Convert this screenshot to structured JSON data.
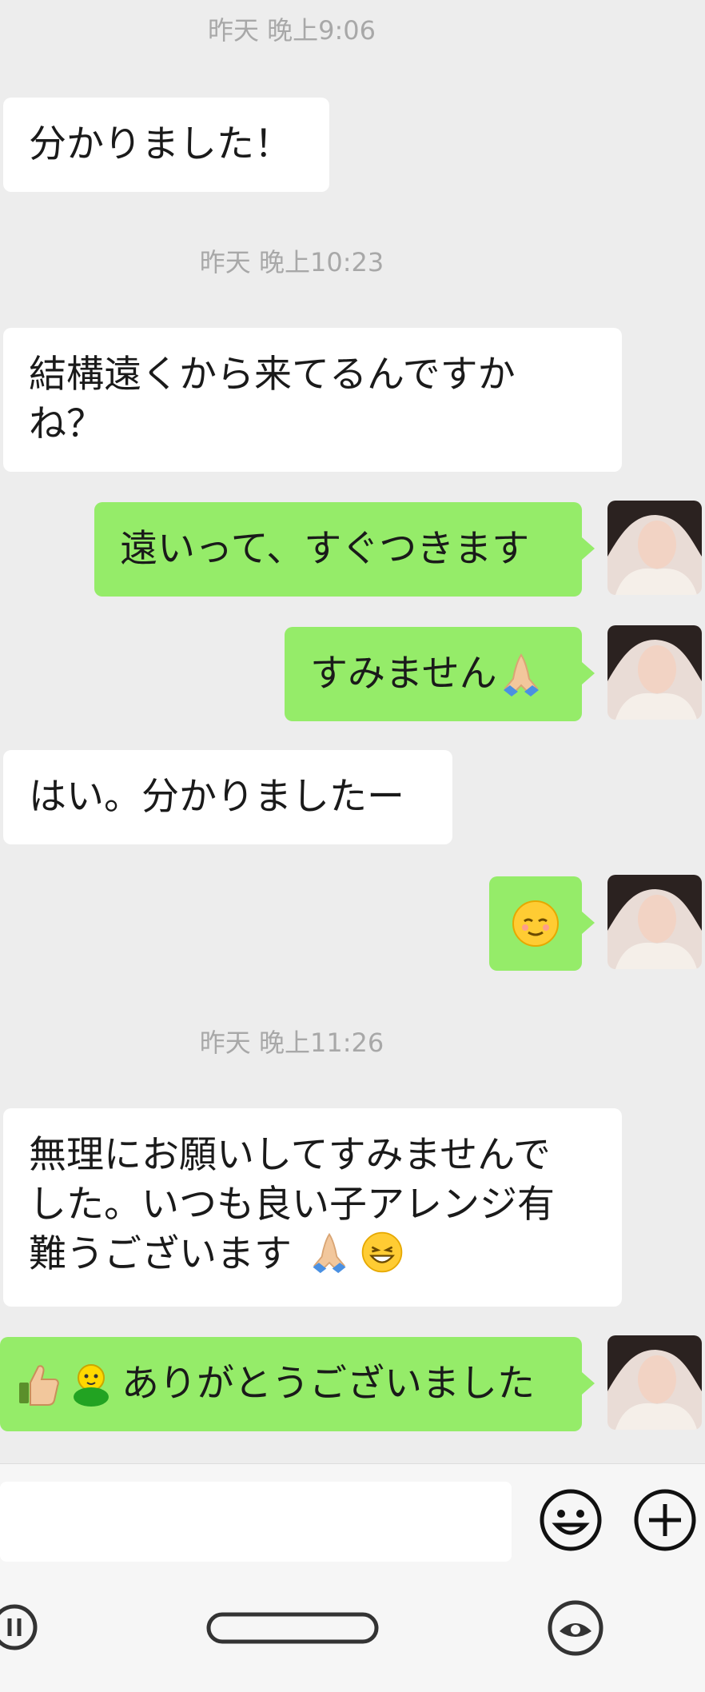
{
  "chat": {
    "timestamps": [
      "昨天 晚上9:06",
      "昨天 晚上10:23",
      "昨天 晚上11:26"
    ],
    "messages": [
      {
        "side": "received",
        "text": "分かりました！"
      },
      {
        "side": "received",
        "text": "結構遠くから来てるんですか\nね？"
      },
      {
        "side": "sent",
        "text": "遠いって、すぐつきます"
      },
      {
        "side": "sent",
        "text": "すみません",
        "emoji": "folded-hands"
      },
      {
        "side": "received",
        "text": "はい。分かりましたー"
      },
      {
        "side": "sent",
        "text": "",
        "emoji": "relieved-face"
      },
      {
        "side": "received",
        "text": "無理にお願いしてすみませんで\nした。いつも良い子アレンジ有\n難うございます",
        "emoji_trailing": [
          "folded-hands",
          "grinning-face"
        ]
      },
      {
        "side": "sent",
        "text": "ありがとうございました",
        "emoji_leading": [
          "thumbs-up",
          "green-bird"
        ]
      }
    ]
  },
  "input_bar": {
    "emoji_button_icon": "smiley-face-icon",
    "more_button_icon": "plus-circle-icon"
  },
  "nav_bar": {
    "left_icon": "recent-apps-icon",
    "center_icon": "home-pill-icon",
    "right_icon": "assistant-icon"
  },
  "colors": {
    "background": "#ededed",
    "sent_bubble": "#95ec69",
    "received_bubble": "#ffffff",
    "timestamp": "#a8a8a8"
  }
}
